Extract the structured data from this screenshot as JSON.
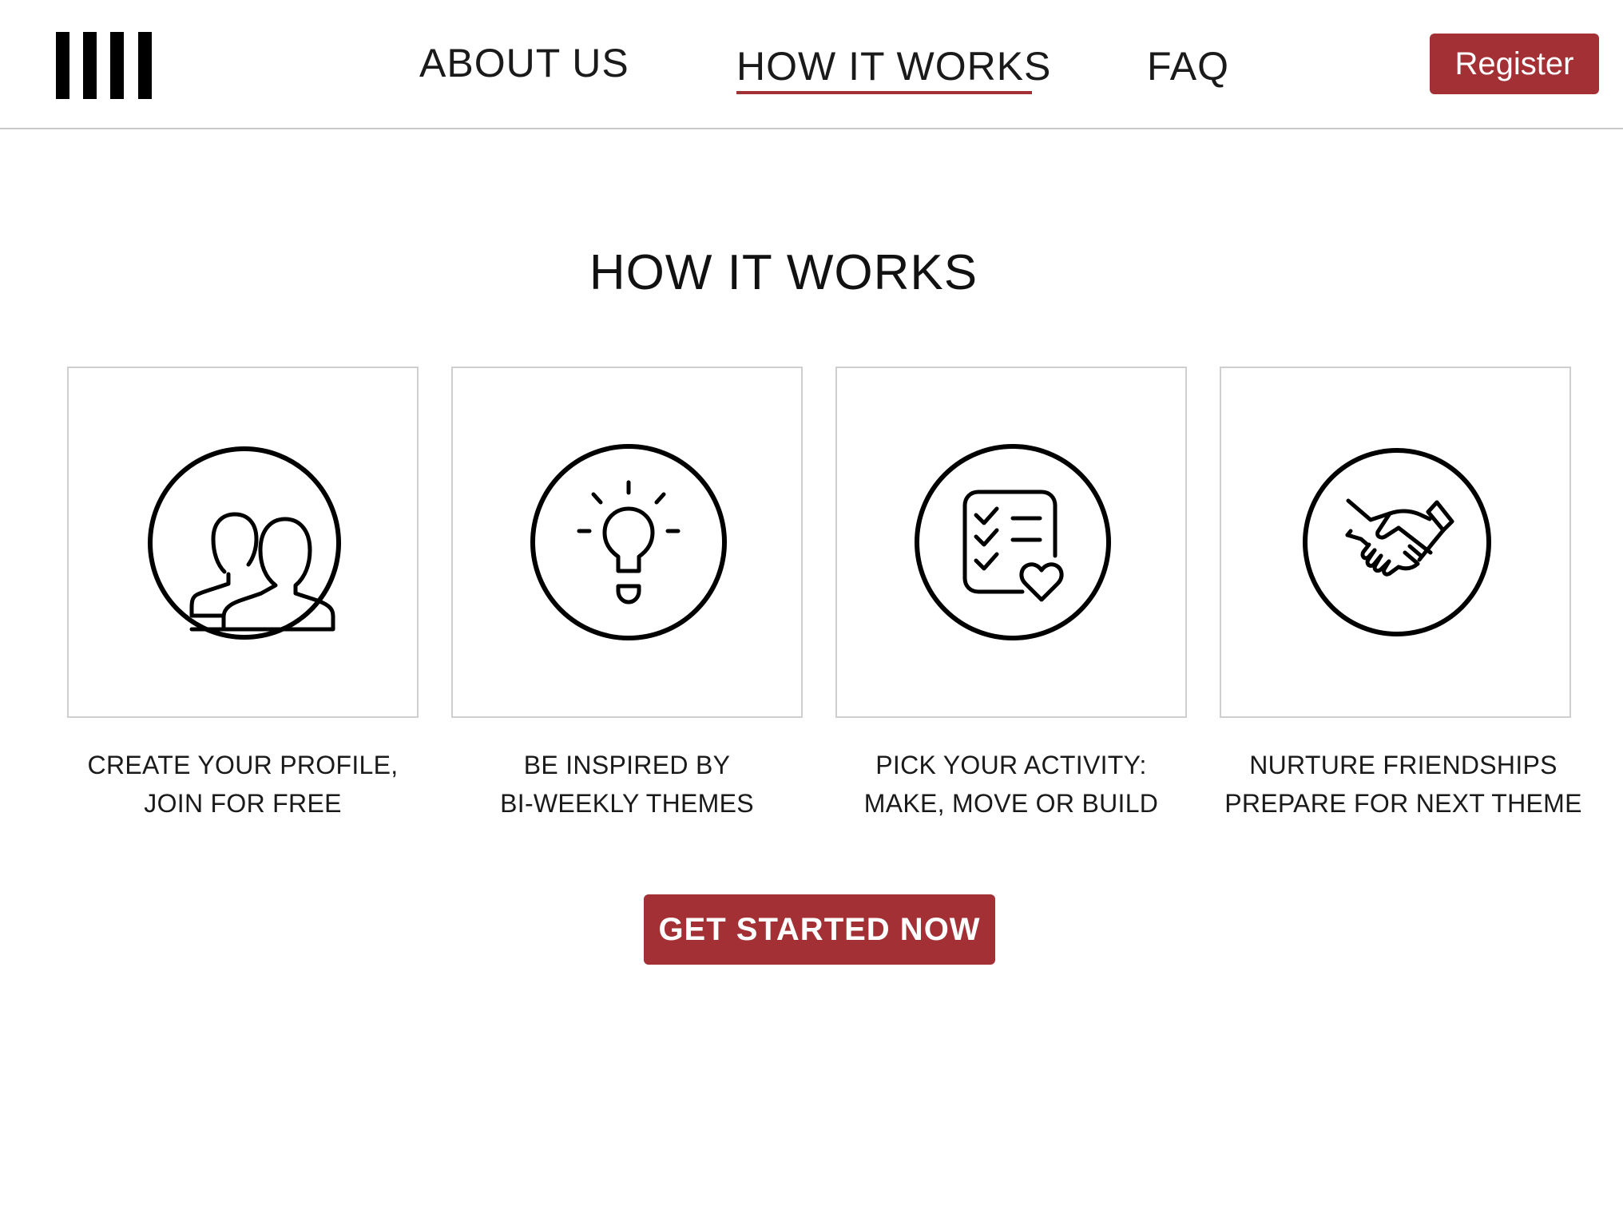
{
  "header": {
    "logo_icon": "barcode-logo",
    "nav": [
      {
        "label": "ABOUT US",
        "active": false
      },
      {
        "label": "HOW IT WORKS",
        "active": true
      },
      {
        "label": "FAQ",
        "active": false
      }
    ],
    "register_label": "Register"
  },
  "main": {
    "title": "HOW IT WORKS",
    "steps": [
      {
        "icon": "people-icon",
        "line1": "CREATE YOUR PROFILE,",
        "line2": "JOIN FOR FREE"
      },
      {
        "icon": "lightbulb-icon",
        "line1": "BE INSPIRED BY",
        "line2": "BI-WEEKLY THEMES"
      },
      {
        "icon": "checklist-heart-icon",
        "line1": "PICK YOUR ACTIVITY:",
        "line2": "MAKE, MOVE OR BUILD"
      },
      {
        "icon": "handshake-icon",
        "line1": "NURTURE FRIENDSHIPS",
        "line2": "PREPARE FOR NEXT THEME"
      }
    ],
    "cta_label": "GET STARTED NOW"
  },
  "colors": {
    "accent": "#a33035",
    "border": "#cfcfcf",
    "text": "#111111"
  }
}
